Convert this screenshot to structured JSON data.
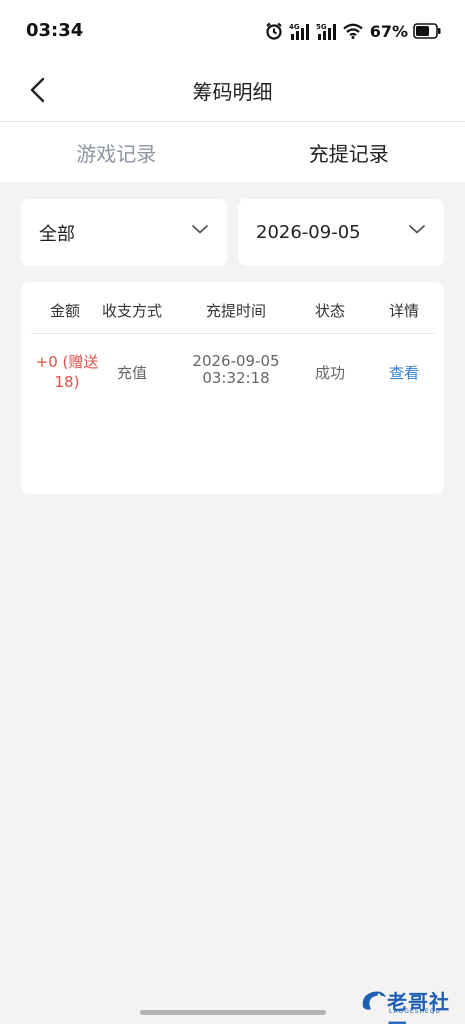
{
  "status_bar": {
    "time": "03:34",
    "network_4g": "4G",
    "network_5g": "5G",
    "battery": "67%"
  },
  "nav": {
    "title": "筹码明细"
  },
  "tabs": [
    {
      "label": "游戏记录",
      "active": false
    },
    {
      "label": "充提记录",
      "active": true
    }
  ],
  "filters": {
    "type": "全部",
    "date": "2026-09-05"
  },
  "table": {
    "headers": [
      "金额",
      "收支方式",
      "充提时间",
      "状态",
      "详情"
    ],
    "rows": [
      {
        "amount_line1": "+0 (赠送",
        "amount_line2": "18)",
        "method": "充值",
        "date": "2026-09-05",
        "time": "03:32:18",
        "status": "成功",
        "detail": "查看"
      }
    ]
  },
  "watermark": {
    "text": "老哥社区",
    "sub": "LAOGESHEQU"
  },
  "colors": {
    "accent_red": "#e0524a",
    "link_blue": "#2f7fd6",
    "tab_inactive": "#8d97a6",
    "background": "#f3f3f4"
  }
}
